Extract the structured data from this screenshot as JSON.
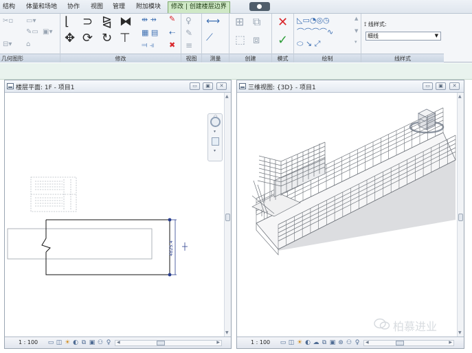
{
  "menu": {
    "tabs": [
      {
        "label": "结构"
      },
      {
        "label": "体量和场地"
      },
      {
        "label": "协作"
      },
      {
        "label": "视图"
      },
      {
        "label": "管理"
      },
      {
        "label": "附加模块"
      },
      {
        "label": "修改"
      },
      {
        "label": "创建楼层边界",
        "prefix": "修改 | "
      }
    ],
    "active_tab": "修改 | 创建楼层边界"
  },
  "ribbon": {
    "panels": {
      "geometry": "几何图形",
      "modify": "修改",
      "view": "视图",
      "measure": "测量",
      "create": "创建",
      "mode": "模式",
      "draw": "绘制",
      "line_style": "线样式"
    },
    "line_style_label": "线样式:",
    "line_style_value": "细线"
  },
  "views": {
    "floor_plan": {
      "title": "楼层平面: 1F - 项目1",
      "scale": "1 : 100",
      "dimension_value": "4825.4"
    },
    "three_d": {
      "title": "三维视图: {3D} - 项目1",
      "scale": "1 : 100"
    }
  },
  "watermark": {
    "text": "柏慕进业"
  },
  "colors": {
    "ribbon_blue": "#3d6fb2",
    "finish_red": "#d9262b",
    "finish_green": "#2f9e3a",
    "context_tab": "#cfe8c6",
    "dimension_blue": "#2a3f8f"
  }
}
